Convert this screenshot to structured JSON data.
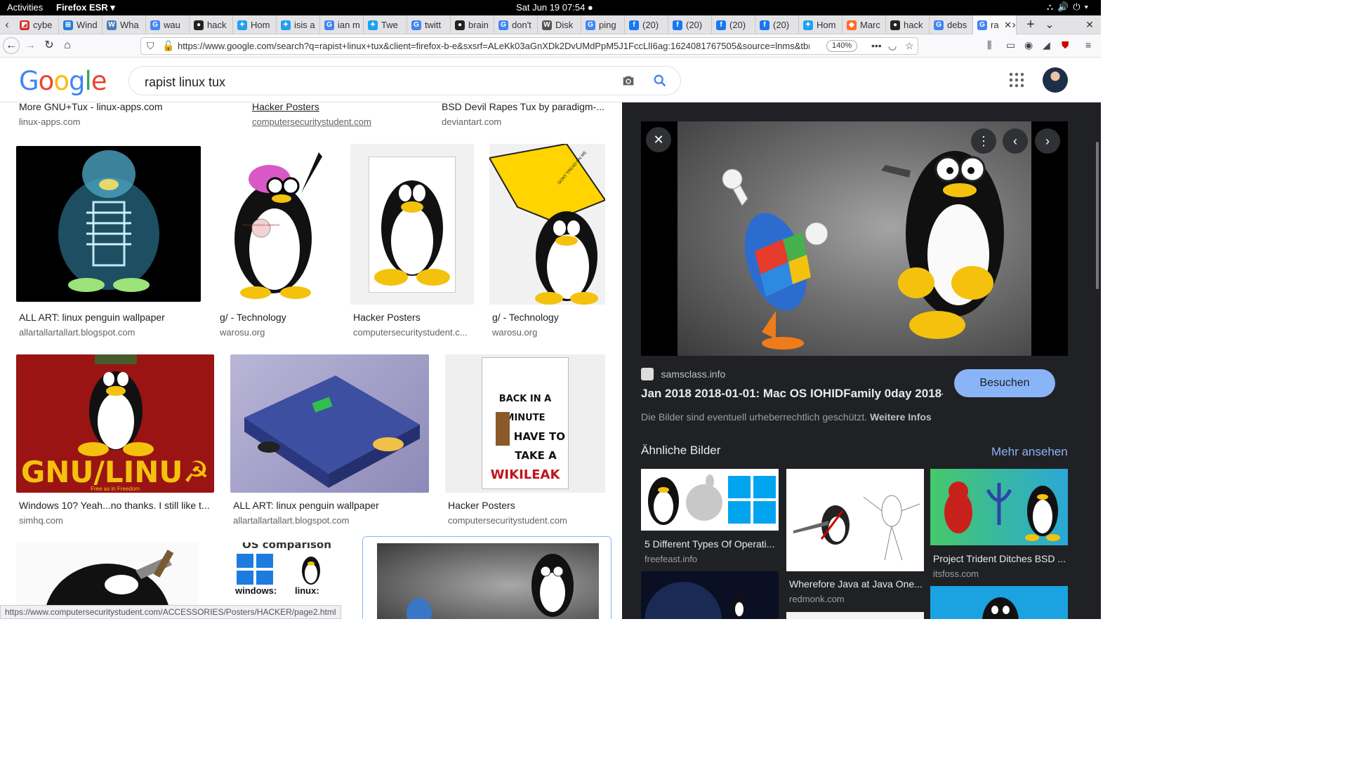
{
  "system": {
    "activities": "Activities",
    "app": "Firefox ESR ▾",
    "clock": "Sat Jun 19  07:54 ●"
  },
  "tabs": [
    {
      "label": "cybe",
      "icon": "◩",
      "color": "#c33"
    },
    {
      "label": "Wind",
      "icon": "⊞",
      "color": "#1e7be0"
    },
    {
      "label": "Wha",
      "icon": "W",
      "color": "#4a7cbc"
    },
    {
      "label": "wau",
      "icon": "G",
      "color": "#4285f4"
    },
    {
      "label": "hack",
      "icon": "●",
      "color": "#222"
    },
    {
      "label": "Hom",
      "icon": "✦",
      "color": "#1da1f2"
    },
    {
      "label": "isis a",
      "icon": "✦",
      "color": "#1da1f2"
    },
    {
      "label": "ian m",
      "icon": "G",
      "color": "#4285f4"
    },
    {
      "label": "Twe",
      "icon": "✦",
      "color": "#1da1f2"
    },
    {
      "label": "twitt",
      "icon": "G",
      "color": "#4285f4"
    },
    {
      "label": "brain",
      "icon": "●",
      "color": "#222"
    },
    {
      "label": "don't",
      "icon": "G",
      "color": "#4285f4"
    },
    {
      "label": "Disk",
      "icon": "W",
      "color": "#555"
    },
    {
      "label": "ping",
      "icon": "G",
      "color": "#4285f4"
    },
    {
      "label": "(20)",
      "icon": "f",
      "color": "#1877f2"
    },
    {
      "label": "(20)",
      "icon": "f",
      "color": "#1877f2"
    },
    {
      "label": "(20)",
      "icon": "f",
      "color": "#1877f2"
    },
    {
      "label": "(20)",
      "icon": "f",
      "color": "#1877f2"
    },
    {
      "label": "Hom",
      "icon": "✦",
      "color": "#1da1f2"
    },
    {
      "label": "Marc",
      "icon": "◆",
      "color": "#fc6d26"
    },
    {
      "label": "hack",
      "icon": "●",
      "color": "#222"
    },
    {
      "label": "debs",
      "icon": "G",
      "color": "#4285f4"
    },
    {
      "label": "ra",
      "icon": "G",
      "color": "#4285f4"
    }
  ],
  "nav": {
    "url": "https://www.google.com/search?q=rapist+linux+tux&client=firefox-b-e&sxsrf=ALeKk03aGnXDk2DvUMdPpM5J1FccLlI6ag:1624081767505&source=lnms&tbm=i",
    "zoom": "140%"
  },
  "google": {
    "logo": "Google",
    "query": "rapist linux tux"
  },
  "results_top": [
    {
      "title": "More GNU+Tux - linux-apps.com",
      "source": "linux-apps.com"
    },
    {
      "title": "Hacker Posters",
      "source": "computersecuritystudent.com"
    },
    {
      "title": "BSD Devil Rapes Tux by paradigm-...",
      "source": "deviantart.com"
    }
  ],
  "results_row1": [
    {
      "title": "ALL ART: linux penguin wallpaper",
      "source": "allartallartallart.blogspot.com"
    },
    {
      "title": "g/ - Technology",
      "source": "warosu.org"
    },
    {
      "title": "Hacker Posters",
      "source": "computersecuritystudent.c..."
    },
    {
      "title": "g/ - Technology",
      "source": "warosu.org"
    }
  ],
  "results_row2": [
    {
      "title": "Windows 10? Yeah...no thanks. I still like t...",
      "source": "simhq.com"
    },
    {
      "title": "ALL ART: linux penguin wallpaper",
      "source": "allartallartallart.blogspot.com"
    },
    {
      "title": "Hacker Posters",
      "source": "computersecuritystudent.com"
    }
  ],
  "thumb_texts": {
    "social": "SOCIAL JUSTICE WARRIOR",
    "flag": "DONT TREAD ON ME",
    "gnu": "GNU/LINU☭",
    "gnu_sub": "Free as in Freedom",
    "back1": "BACK IN A MINUTE",
    "back2": "I HAVE TO",
    "back3": "TAKE A",
    "back4": "WIKILEAK",
    "os": "OS comparison",
    "win": "windows:",
    "lin": "linux:"
  },
  "panel": {
    "source": "samsclass.info",
    "title": "Jan 2018 2018-01-01: Mac OS IOHIDFamily 0day 2018-...",
    "visit": "Besuchen",
    "copyright": "Die Bilder sind eventuell urheberrechtlich geschützt.",
    "copyright_link": "Weitere Infos",
    "similar": "Ähnliche Bilder",
    "more": "Mehr ansehen",
    "similar_items": [
      {
        "title": "5 Different Types Of Operati...",
        "source": "freefeast.info"
      },
      {
        "title": "Wherefore Java at Java One...",
        "source": "redmonk.com"
      },
      {
        "title": "Project Trident Ditches BSD ...",
        "source": "itsfoss.com"
      }
    ]
  },
  "status_url": "https://www.computersecuritystudent.com/ACCESSORIES/Posters/HACKER/page2.html"
}
